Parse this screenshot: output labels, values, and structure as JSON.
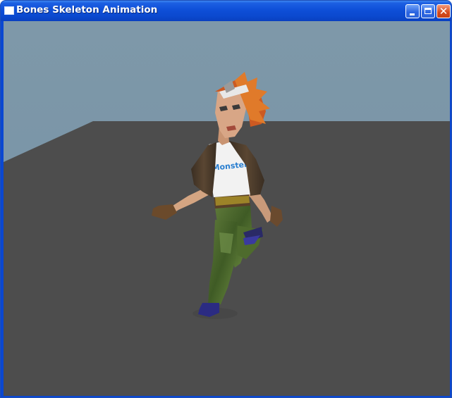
{
  "window": {
    "title": "Bones Skeleton Animation",
    "icon": "window-app-icon",
    "controls": {
      "minimize_icon": "minimize-icon",
      "maximize_icon": "maximize-icon",
      "close_icon": "close-icon",
      "close_glyph": "✕"
    }
  },
  "scene": {
    "sky_color": "#7995a6",
    "floor_color": "#4d4d4d",
    "character_shirt_text": "Monster"
  }
}
